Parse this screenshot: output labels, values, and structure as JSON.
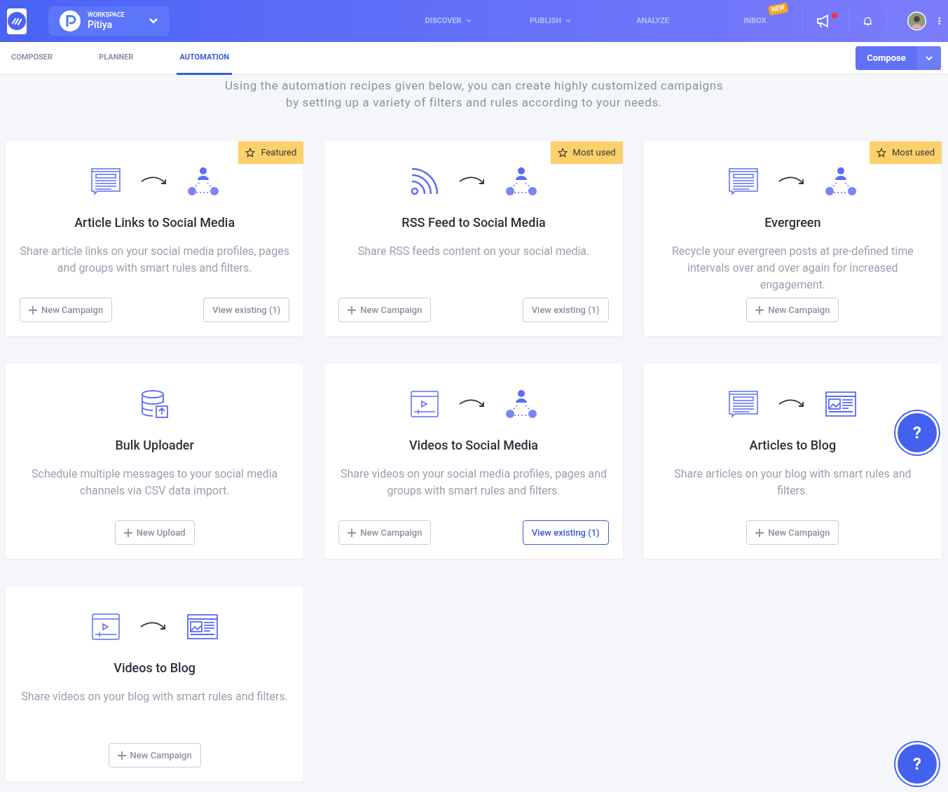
{
  "topbar": {
    "workspace_label": "WORKSPACE",
    "workspace_name": "Pitiya",
    "nav": [
      {
        "label": "DISCOVER",
        "dropdown": true
      },
      {
        "label": "PUBLISH",
        "dropdown": true
      },
      {
        "label": "ANALYZE",
        "dropdown": false
      },
      {
        "label": "INBOX",
        "dropdown": false,
        "badge": "NEW"
      }
    ],
    "announcement_dot": true
  },
  "tabs": [
    {
      "label": "COMPOSER",
      "selected": false
    },
    {
      "label": "PLANNER",
      "selected": false
    },
    {
      "label": "AUTOMATION",
      "selected": true
    }
  ],
  "compose_button": "Compose",
  "intro": [
    "Using the automation recipes given below, you can create highly customized campaigns",
    "by setting up a variety of filters and rules according to your needs."
  ],
  "cards": [
    {
      "source": {
        "kind": "article"
      },
      "target": {
        "kind": "social"
      },
      "badge": "Featured",
      "title": "Article Links to Social Media",
      "description": "Share article links on your social media profiles, pages and groups with smart rules and filters.",
      "buttons": [
        {
          "kind": "new",
          "label": "New Campaign",
          "highlighted": false
        },
        {
          "kind": "view",
          "label": "View existing (1)",
          "highlighted": false
        }
      ]
    },
    {
      "source": {
        "kind": "rss"
      },
      "target": {
        "kind": "social"
      },
      "badge": "Most used",
      "title": "RSS Feed to Social Media",
      "description": "Share RSS feeds content on your social media.",
      "buttons": [
        {
          "kind": "new",
          "label": "New Campaign",
          "highlighted": false
        },
        {
          "kind": "view",
          "label": "View existing (1)",
          "highlighted": false
        }
      ]
    },
    {
      "source": {
        "kind": "article"
      },
      "target": {
        "kind": "social"
      },
      "badge": "Most used",
      "title": "Evergreen",
      "description": "Recycle your evergreen posts at pre-defined time intervals over and over again for increased engagement.",
      "buttons": [
        {
          "kind": "new",
          "label": "New Campaign",
          "highlighted": false
        }
      ]
    },
    {
      "source": {
        "kind": "database"
      },
      "title": "Bulk Uploader",
      "description": "Schedule multiple messages to your social media channels via CSV data import.",
      "buttons": [
        {
          "kind": "new",
          "label": "New Upload",
          "highlighted": false
        }
      ]
    },
    {
      "source": {
        "kind": "video"
      },
      "target": {
        "kind": "social"
      },
      "title": "Videos to Social Media",
      "description": "Share videos on your social media profiles, pages and groups with smart rules and filters.",
      "buttons": [
        {
          "kind": "new",
          "label": "New Campaign",
          "highlighted": false
        },
        {
          "kind": "view",
          "label": "View existing (1)",
          "highlighted": true
        }
      ]
    },
    {
      "source": {
        "kind": "article"
      },
      "target": {
        "kind": "blog"
      },
      "title": "Articles to Blog",
      "description": "Share articles on your blog with smart rules and filters.",
      "buttons": [
        {
          "kind": "new",
          "label": "New Campaign",
          "highlighted": false
        }
      ]
    },
    {
      "source": {
        "kind": "video"
      },
      "target": {
        "kind": "blog"
      },
      "title": "Videos to Blog",
      "description": "Share videos on your blog with smart rules and filters.",
      "buttons": [
        {
          "kind": "new",
          "label": "New Campaign",
          "highlighted": false
        }
      ]
    }
  ],
  "help_buttons": [
    "?",
    "?"
  ]
}
